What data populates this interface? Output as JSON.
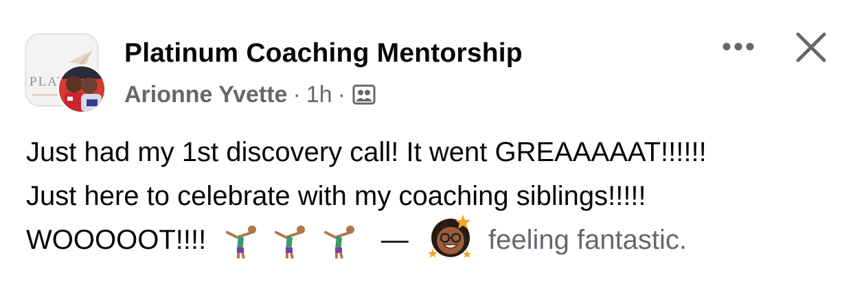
{
  "header": {
    "group_name": "Platinum Coaching Mentorship",
    "group_thumb_text": "PLAT",
    "author": "Arionne Yvette",
    "separator": "·",
    "time": "1h",
    "audience_icon": "group-audience-icon"
  },
  "actions": {
    "more_icon": "more-horizontal-icon",
    "close_icon": "close-icon"
  },
  "post": {
    "line1": "Just had my 1st discovery call! It went GREAAAAAT!!!!!!",
    "line2": "Just here to celebrate with my coaching siblings!!!!!",
    "line3_text": "WOOOOOT!!!!",
    "emojis": [
      "person-doing-cartwheel-icon",
      "person-doing-cartwheel-icon",
      "person-doing-cartwheel-icon"
    ],
    "dash": "—",
    "feeling_icon": "feeling-fantastic-icon",
    "feeling_text": "feeling fantastic."
  }
}
